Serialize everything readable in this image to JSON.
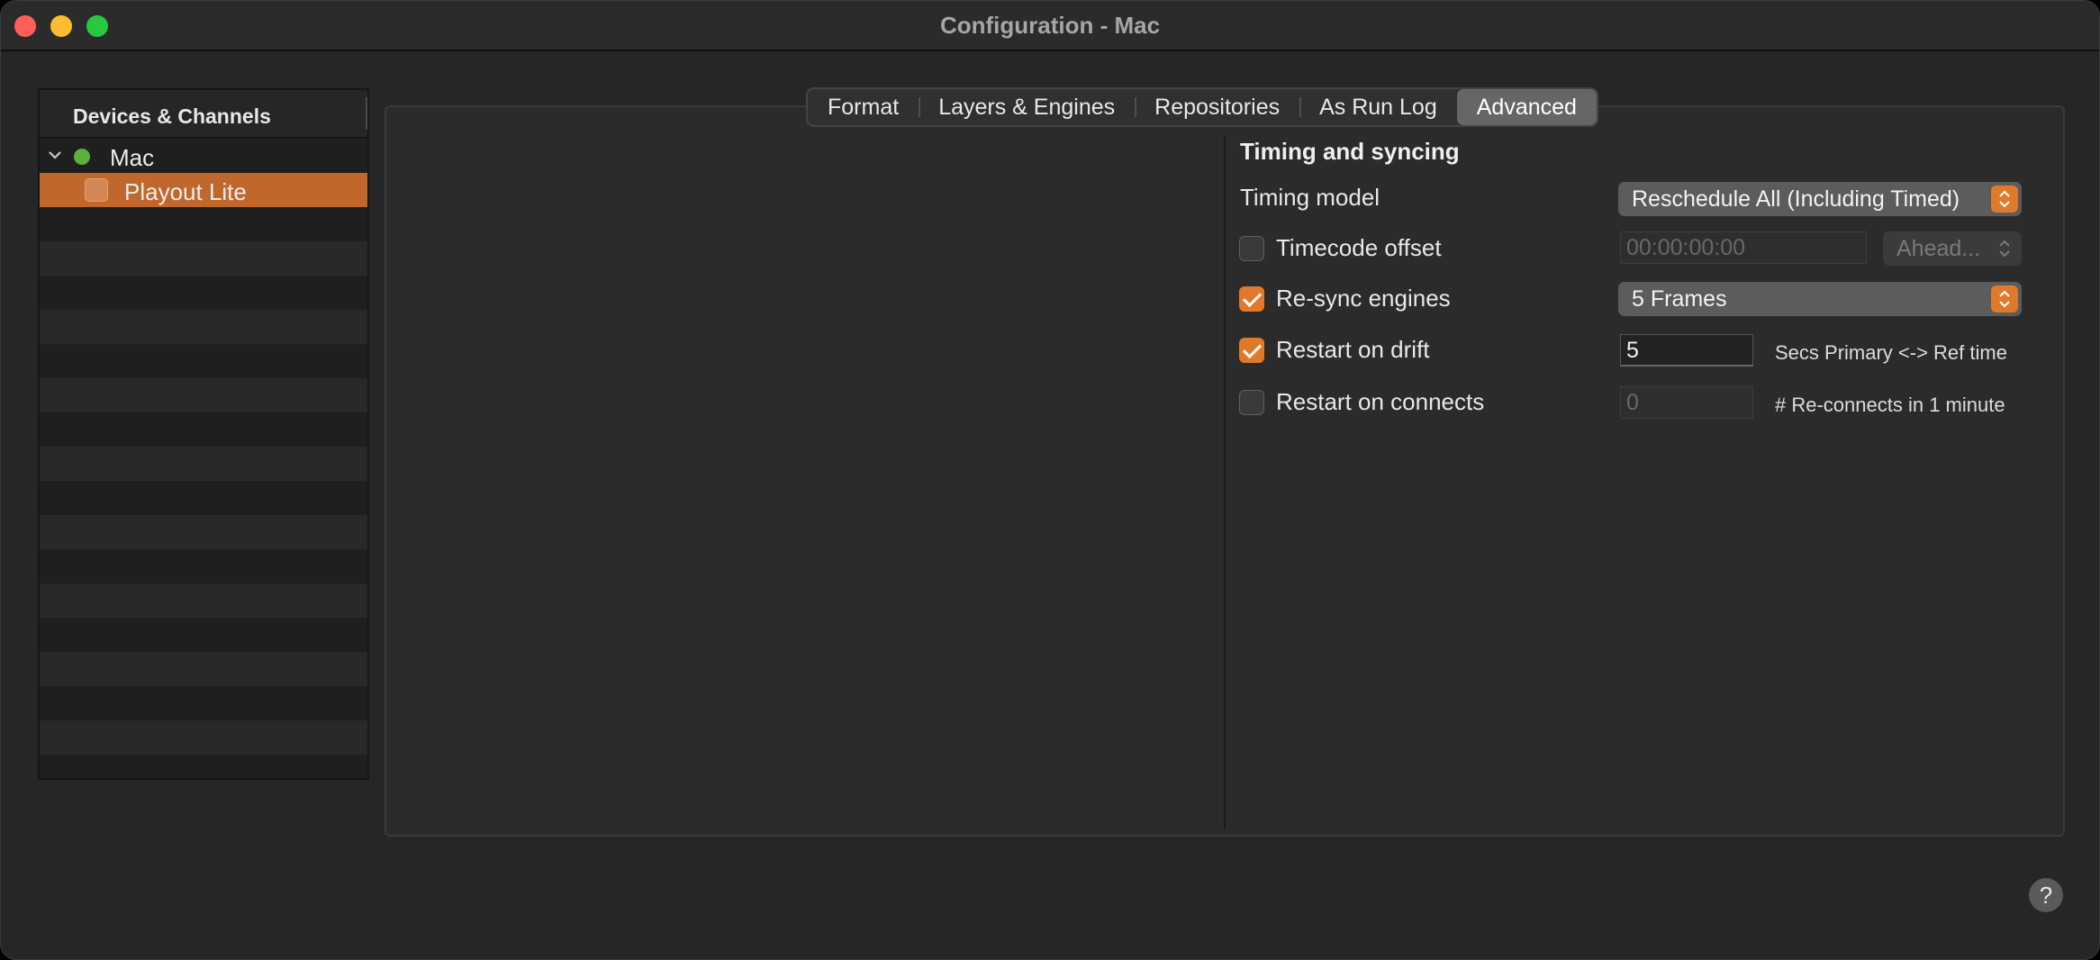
{
  "window": {
    "title": "Configuration - Mac"
  },
  "sidebar": {
    "header": "Devices & Channels",
    "items": [
      {
        "label": "Mac",
        "status_color": "#5cb13c",
        "expanded": true
      },
      {
        "label": "Playout Lite",
        "selected": true,
        "checked": false
      }
    ]
  },
  "tabs": [
    {
      "label": "Format",
      "active": false
    },
    {
      "label": "Layers & Engines",
      "active": false
    },
    {
      "label": "Repositories",
      "active": false
    },
    {
      "label": "As Run Log",
      "active": false
    },
    {
      "label": "Advanced",
      "active": true
    }
  ],
  "timing": {
    "section_title": "Timing and syncing",
    "timing_model": {
      "label": "Timing model",
      "value": "Reschedule All (Including Timed)"
    },
    "timecode_offset": {
      "label": "Timecode offset",
      "checked": false,
      "value": "00:00:00:00",
      "direction": "Ahead..."
    },
    "resync_engines": {
      "label": "Re-sync engines",
      "checked": true,
      "value": "5 Frames"
    },
    "restart_on_drift": {
      "label": "Restart on drift",
      "checked": true,
      "value": "5",
      "unit": "Secs Primary <-> Ref time"
    },
    "restart_on_connects": {
      "label": "Restart on connects",
      "checked": false,
      "value": "0",
      "unit": "# Re-connects in 1 minute"
    }
  },
  "help": {
    "label": "?"
  },
  "colors": {
    "accent": "#e07a2a",
    "selection": "#c0682b"
  }
}
